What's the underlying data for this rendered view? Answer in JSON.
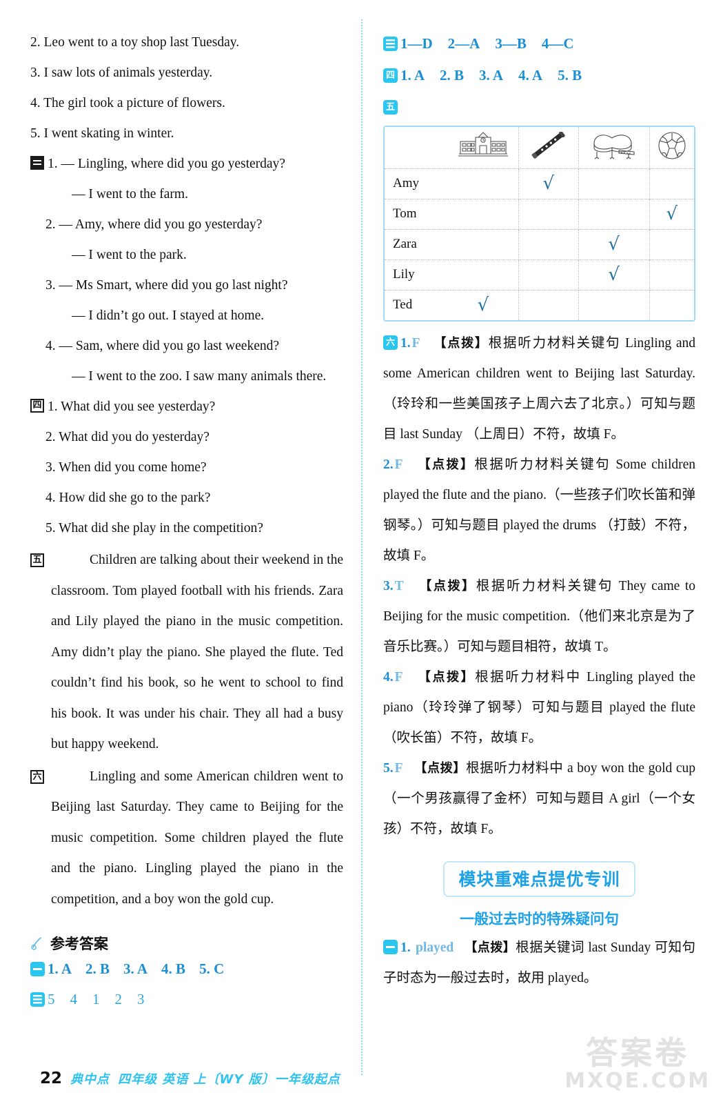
{
  "left": {
    "listening_sentences": [
      "2. Leo went to a toy shop last Tuesday.",
      "3. I saw lots of animals yesterday.",
      "4. The girl took a picture of flowers.",
      "5. I went skating in winter."
    ],
    "section3": {
      "marker": "三",
      "items": [
        "1. — Lingling, where did you go yesterday?",
        "— I went to the farm.",
        "2. — Amy, where did you go yesterday?",
        "— I went to the park.",
        "3. — Ms Smart, where did you go last night?",
        "— I didn’t go out. I stayed at home.",
        "4. — Sam, where did you go last weekend?",
        "— I went to the zoo. I saw many animals there."
      ]
    },
    "section4": {
      "marker": "四",
      "items": [
        "1. What did you see yesterday?",
        "2. What did you do yesterday?",
        "3. When did you come home?",
        "4. How did she go to the park?",
        "5. What did she play in the competition?"
      ]
    },
    "section5": {
      "marker": "五",
      "paragraph": "Children are talking about their weekend in the classroom. Tom played football with his friends. Zara and Lily played the piano in the music competition. Amy didn’t play the piano. She played the flute. Ted couldn’t find his book, so he went to school to find his book. It was under his chair. They all had a busy but happy weekend."
    },
    "section6": {
      "marker": "六",
      "paragraph": "Lingling and some American children went to Beijing last Saturday. They came to Beijing for the music competition. Some children played the flute and the piano. Lingling played the piano in the competition, and a boy won the gold cup."
    },
    "answer_key": {
      "icon": "pen-icon",
      "title": "参考答案",
      "rows": [
        {
          "marker": "一",
          "marker_style": "bars1",
          "answers": [
            "1. A",
            "2. B",
            "3. A",
            "4. B",
            "5. C"
          ]
        },
        {
          "marker": "二",
          "marker_style": "bars3",
          "answers": [
            "5",
            "4",
            "1",
            "2",
            "3"
          ]
        }
      ]
    },
    "footer": {
      "page_number": "22",
      "brand": "典中点",
      "desc": "四年级  英语  上〔WY 版〕一年级起点"
    }
  },
  "right": {
    "answers_three": {
      "marker": "三",
      "marker_style": "bars3",
      "pairs": [
        "1—D",
        "2—A",
        "3—B",
        "4—C"
      ]
    },
    "answers_four": {
      "marker": "四",
      "answers": [
        "1. A",
        "2. B",
        "3. A",
        "4. A",
        "5. B"
      ]
    },
    "answers_five": {
      "marker": "五",
      "table": {
        "columns": [
          "school-icon",
          "flute-icon",
          "piano-icon",
          "football-icon"
        ],
        "rows": [
          {
            "name": "Amy",
            "checks": [
              false,
              true,
              false,
              false
            ]
          },
          {
            "name": "Tom",
            "checks": [
              false,
              false,
              false,
              true
            ]
          },
          {
            "name": "Zara",
            "checks": [
              false,
              false,
              true,
              false
            ]
          },
          {
            "name": "Lily",
            "checks": [
              false,
              false,
              true,
              false
            ]
          },
          {
            "name": "Ted",
            "checks": [
              true,
              false,
              false,
              false
            ]
          }
        ],
        "check_mark": "√"
      }
    },
    "explanations": {
      "marker": "六",
      "tip_label": "【点拨】",
      "items": [
        {
          "num": "1.",
          "answer": "F",
          "text": "根据听力材料关键句 Lingling and some American children went to Beijing last Saturday.（玲玲和一些美国孩子上周六去了北京。）可知与题目 last Sunday （上周日）不符，故填 F。"
        },
        {
          "num": "2.",
          "answer": "F",
          "text": "根据听力材料关键句 Some children played the flute and the piano.（一些孩子们吹长笛和弹钢琴。）可知与题目 played the drums （打鼓）不符，故填 F。"
        },
        {
          "num": "3.",
          "answer": "T",
          "text": "根据听力材料关键句 They came to Beijing for the music competition.（他们来北京是为了音乐比赛。）可知与题目相符，故填 T。"
        },
        {
          "num": "4.",
          "answer": "F",
          "text": "根据听力材料中 Lingling played the piano（玲玲弹了钢琴）可知与题目 played the flute（吹长笛）不符，故填 F。"
        },
        {
          "num": "5.",
          "answer": "F",
          "text": "根据听力材料中 a boy won the gold cup（一个男孩赢得了金杯）可知与题目 A girl（一个女孩）不符，故填 F。"
        }
      ]
    },
    "banner": "模块重难点提优专训",
    "subtitle": "一般过去时的特殊疑问句",
    "training": {
      "marker": "一",
      "marker_style": "bars1",
      "num": "1.",
      "answer": "played",
      "tip_label": "【点拨】",
      "text": "根据关键词 last Sunday 可知句子时态为一般过去时，故用 played。"
    },
    "watermark": {
      "line1": "答案卷",
      "line2": "MXQE.COM"
    }
  }
}
